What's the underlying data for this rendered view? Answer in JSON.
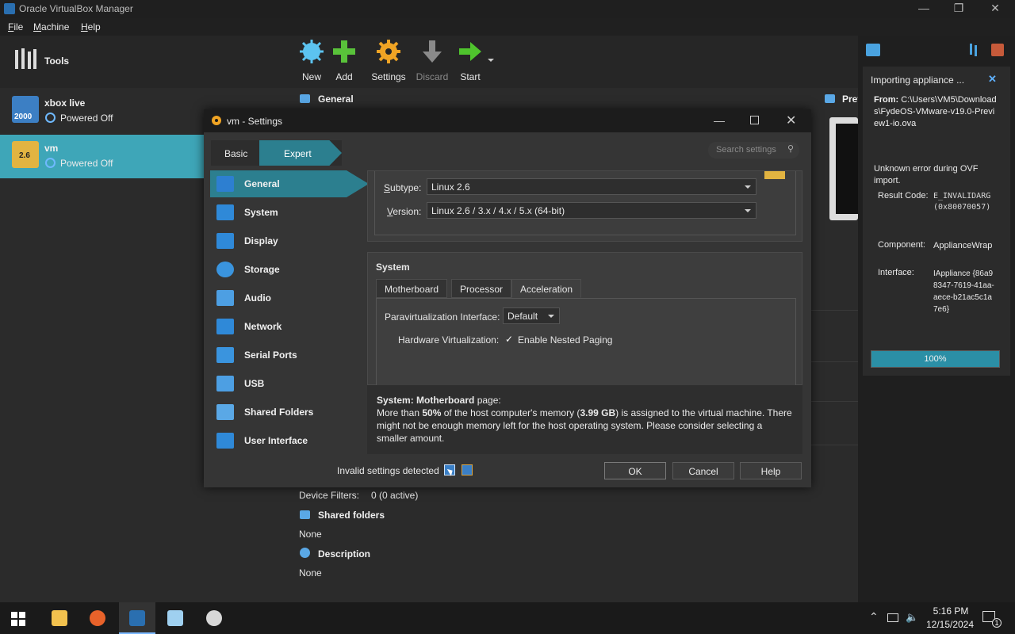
{
  "window": {
    "title": "Oracle VirtualBox Manager"
  },
  "menu": {
    "file": "File",
    "machine": "Machine",
    "help": "Help"
  },
  "tools": {
    "label": "Tools"
  },
  "vms": [
    {
      "name": "xbox live",
      "state": "Powered Off",
      "badge": "2000"
    },
    {
      "name": "vm",
      "state": "Powered Off",
      "badge": "2.6"
    }
  ],
  "toolbar": {
    "new": "New",
    "add": "Add",
    "settings": "Settings",
    "discard": "Discard",
    "start": "Start"
  },
  "details": {
    "general_header": "General",
    "preview_header": "Previ",
    "device_filters_label": "Device Filters:",
    "device_filters_value": "0 (0 active)",
    "shared_folders_header": "Shared folders",
    "shared_folders_value": "None",
    "description_header": "Description",
    "description_value": "None"
  },
  "dialog": {
    "title": "vm - Settings",
    "mode_basic": "Basic",
    "mode_expert": "Expert",
    "search_placeholder": "Search settings",
    "nav": [
      {
        "label": "General",
        "icon": "general-icon",
        "color": "#2d7fd1"
      },
      {
        "label": "System",
        "icon": "system-icon",
        "color": "#2f89d8"
      },
      {
        "label": "Display",
        "icon": "display-icon",
        "color": "#2f89d8"
      },
      {
        "label": "Storage",
        "icon": "storage-icon",
        "color": "#3a94de"
      },
      {
        "label": "Audio",
        "icon": "audio-icon",
        "color": "#4d9fe3"
      },
      {
        "label": "Network",
        "icon": "network-icon",
        "color": "#2f89d8"
      },
      {
        "label": "Serial Ports",
        "icon": "serial-ports-icon",
        "color": "#3a94de"
      },
      {
        "label": "USB",
        "icon": "usb-icon",
        "color": "#4d9fe3"
      },
      {
        "label": "Shared Folders",
        "icon": "folder-icon",
        "color": "#5aa8e6"
      },
      {
        "label": "User Interface",
        "icon": "user-interface-icon",
        "color": "#2f89d8"
      }
    ],
    "subtype_label": "Subtype:",
    "subtype_value": "Linux 2.6",
    "version_label": "Version:",
    "version_value": "Linux 2.6 / 3.x / 4.x / 5.x (64-bit)",
    "system_header": "System",
    "tabs": [
      "Motherboard",
      "Processor",
      "Acceleration"
    ],
    "paravirt_label": "Paravirtualization Interface:",
    "paravirt_value": "Default",
    "hwvirt_label": "Hardware Virtualization:",
    "nested_paging_label": "Enable Nested Paging",
    "nested_paging_checked": true,
    "message_title": "System: Motherboard",
    "message_title_suffix": " page:",
    "message_part1": "More than ",
    "message_bold1": "50%",
    "message_part2": " of the host computer's memory (",
    "message_bold2": "3.99 GB",
    "message_part3": ") is assigned to the virtual machine. There might not be enough memory left for the host operating system. Please consider selecting a smaller amount.",
    "invalid_settings": "Invalid settings detected",
    "ok": "OK",
    "cancel": "Cancel",
    "help": "Help"
  },
  "notification": {
    "title": "Importing appliance ...",
    "from_label": "From:",
    "from_value": "C:\\Users\\VM5\\Downloads\\FydeOS-VMware-v19.0-Preview1-io.ova",
    "error": "Unknown error during OVF import.",
    "result_code_label": "Result Code:",
    "result_code_value": "E_INVALIDARG (0x80070057)",
    "component_label": "Component:",
    "component_value": "ApplianceWrap",
    "interface_label": "Interface:",
    "interface_value": "IAppliance {86a98347-7619-41aa-aece-b21ac5c1a7e6}",
    "progress_text": "100%",
    "progress": 1.0
  },
  "taskbar": {
    "time": "5:16 PM",
    "date": "12/15/2024",
    "notif_count": "1"
  },
  "colors": {
    "accent": "#2c7f8f",
    "selection": "#3ea6b8",
    "progress": "#2b8fa6"
  }
}
